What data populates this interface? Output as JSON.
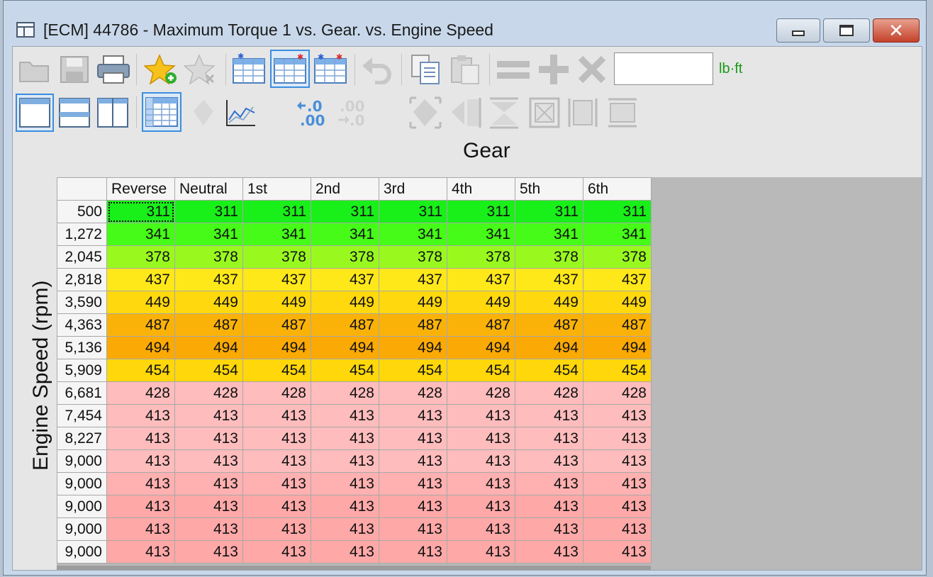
{
  "window": {
    "title": "[ECM] 44786 - Maximum Torque 1 vs. Gear. vs. Engine Speed"
  },
  "toolbar": {
    "unit": "lb·ft",
    "value_input": "",
    "row1_icons": [
      "open-folder-icon",
      "save-icon",
      "print-icon",
      "add-favorite-icon",
      "remove-favorite-icon",
      "table-compare-a-icon",
      "table-compare-b-icon",
      "table-compare-c-icon",
      "undo-icon",
      "copy-icon",
      "paste-icon",
      "equals-icon",
      "plus-icon",
      "multiply-icon"
    ],
    "row2_icons": [
      "single-view-icon",
      "split-horizontal-icon",
      "split-vertical-icon",
      "table-view-icon",
      "fill-diamond-icon",
      "graph-icon",
      "increase-decimal-icon",
      "decrease-decimal-icon",
      "smooth-icon",
      "interpolate-left-icon",
      "interpolate-down-icon",
      "fill-box-icon",
      "fill-columns-icon",
      "fill-rows-icon"
    ]
  },
  "table": {
    "x_axis_title": "Gear",
    "y_axis_title": "Engine Speed (rpm)",
    "columns": [
      "Reverse",
      "Neutral",
      "1st",
      "2nd",
      "3rd",
      "4th",
      "5th",
      "6th"
    ],
    "rows": [
      {
        "rpm": "500",
        "value": "311",
        "color": "#19ef19"
      },
      {
        "rpm": "1,272",
        "value": "341",
        "color": "#45fb17"
      },
      {
        "rpm": "2,045",
        "value": "378",
        "color": "#99f91f"
      },
      {
        "rpm": "2,818",
        "value": "437",
        "color": "#ffe81a"
      },
      {
        "rpm": "3,590",
        "value": "449",
        "color": "#ffd80e"
      },
      {
        "rpm": "4,363",
        "value": "487",
        "color": "#fbb208"
      },
      {
        "rpm": "5,136",
        "value": "494",
        "color": "#fba904"
      },
      {
        "rpm": "5,909",
        "value": "454",
        "color": "#ffd70a"
      },
      {
        "rpm": "6,681",
        "value": "428",
        "color": "#ffbcbc"
      },
      {
        "rpm": "7,454",
        "value": "413",
        "color": "#ffbcbc"
      },
      {
        "rpm": "8,227",
        "value": "413",
        "color": "#ffbcbc"
      },
      {
        "rpm": "9,000",
        "value": "413",
        "color": "#ffbcbc"
      },
      {
        "rpm": "9,000",
        "value": "413",
        "color": "#ffb0b0"
      },
      {
        "rpm": "9,000",
        "value": "413",
        "color": "#ffa8a8"
      },
      {
        "rpm": "9,000",
        "value": "413",
        "color": "#ffa8a8"
      },
      {
        "rpm": "9,000",
        "value": "413",
        "color": "#ffa8a8"
      }
    ]
  },
  "colors": {
    "selection": "#3b8ede",
    "unit_text": "#189a18"
  }
}
